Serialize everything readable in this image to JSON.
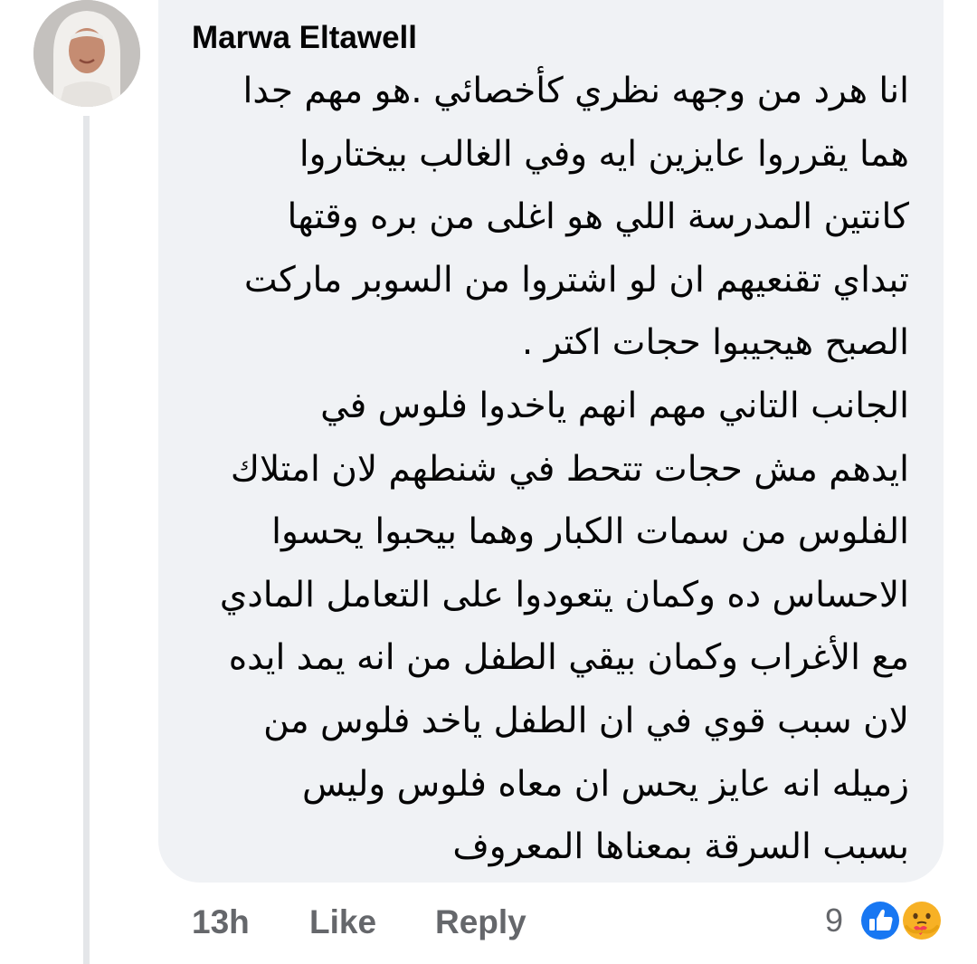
{
  "comment": {
    "author": "Marwa Eltawell",
    "lines": [
      "انا هرد من وجهه نظري كأخصائي .هو مهم جدا",
      "هما يقرروا عايزين ايه وفي الغالب بيختاروا",
      "كانتين المدرسة اللي هو اغلى من بره وقتها",
      "تبداي تقنعيهم ان لو اشتروا من السوبر ماركت",
      "الصبح هيجيبوا حجات اكتر .",
      "الجانب التاني مهم انهم ياخدوا فلوس في",
      "ايدهم مش حجات تتحط في شنطهم لان امتلاك",
      "الفلوس من سمات الكبار وهما بيحبوا يحسوا",
      "الاحساس ده وكمان يتعودوا على التعامل المادي",
      "مع الأغراب وكمان بيقي الطفل من انه يمد ايده",
      "لان سبب قوي في ان الطفل ياخد فلوس من",
      "زميله انه عايز يحس ان معاه فلوس وليس",
      "بسبب السرقة بمعناها المعروف"
    ],
    "timestamp": "13h",
    "like_label": "Like",
    "reply_label": "Reply",
    "reaction_count": "9",
    "reactions": [
      "like-reaction-icon",
      "care-reaction-icon"
    ]
  },
  "colors": {
    "bubble": "#f0f2f5",
    "text": "#050505",
    "meta": "#65676b",
    "like_blue": "#1877f2",
    "care_yellow": "#f7b125"
  }
}
